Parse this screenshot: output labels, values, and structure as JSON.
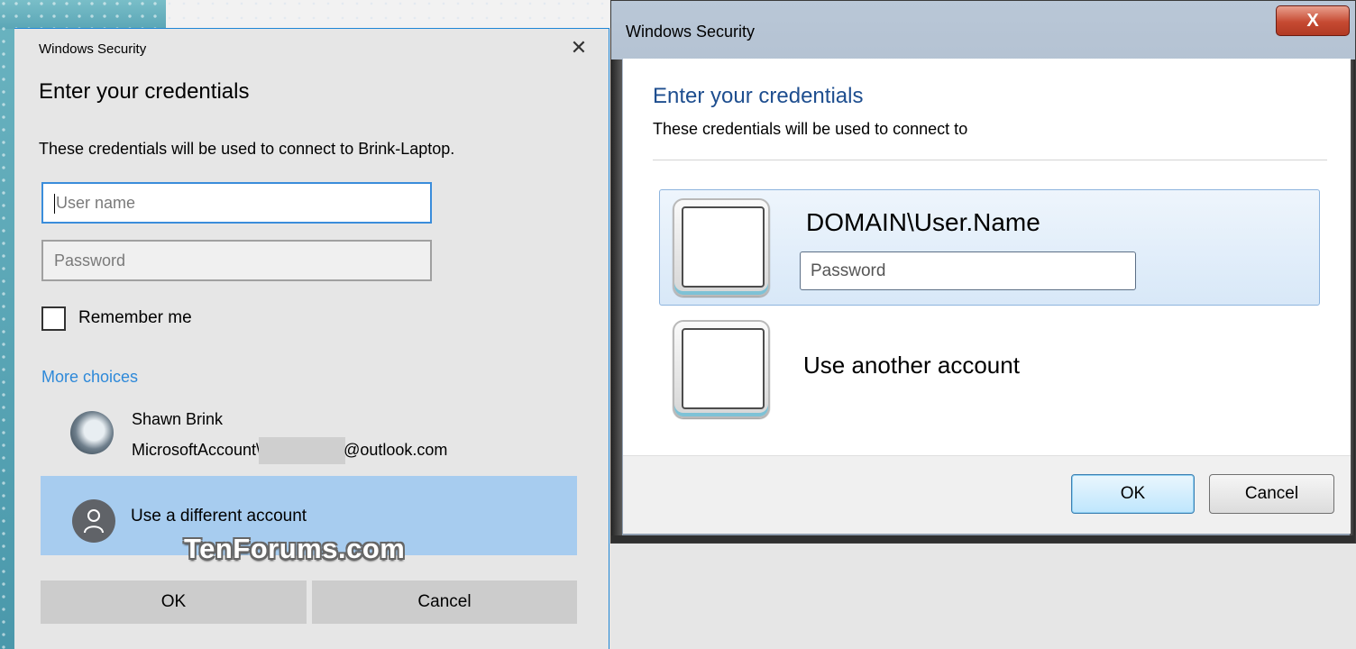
{
  "left_dialog": {
    "title": "Windows Security",
    "close_glyph": "✕",
    "heading": "Enter your credentials",
    "description": "These credentials will be used to connect to Brink-Laptop.",
    "username_placeholder": "User name",
    "password_placeholder": "Password",
    "remember_label": "Remember me",
    "remember_checked": false,
    "more_choices": "More choices",
    "account": {
      "name": "Shawn Brink",
      "email_prefix": "MicrosoftAccount\\",
      "email_suffix": "@outlook.com"
    },
    "different_account": "Use a different account",
    "watermark": "TenForums.com",
    "ok_label": "OK",
    "cancel_label": "Cancel",
    "accent_color": "#2e89d9"
  },
  "right_dialog": {
    "title": "Windows Security",
    "close_glyph": "X",
    "heading": "Enter your credentials",
    "description": "These credentials will be used to connect to",
    "account_name": "DOMAIN\\User.Name",
    "password_placeholder": "Password",
    "another_account": "Use another account",
    "ok_label": "OK",
    "cancel_label": "Cancel",
    "heading_color": "#1e4e8f"
  }
}
